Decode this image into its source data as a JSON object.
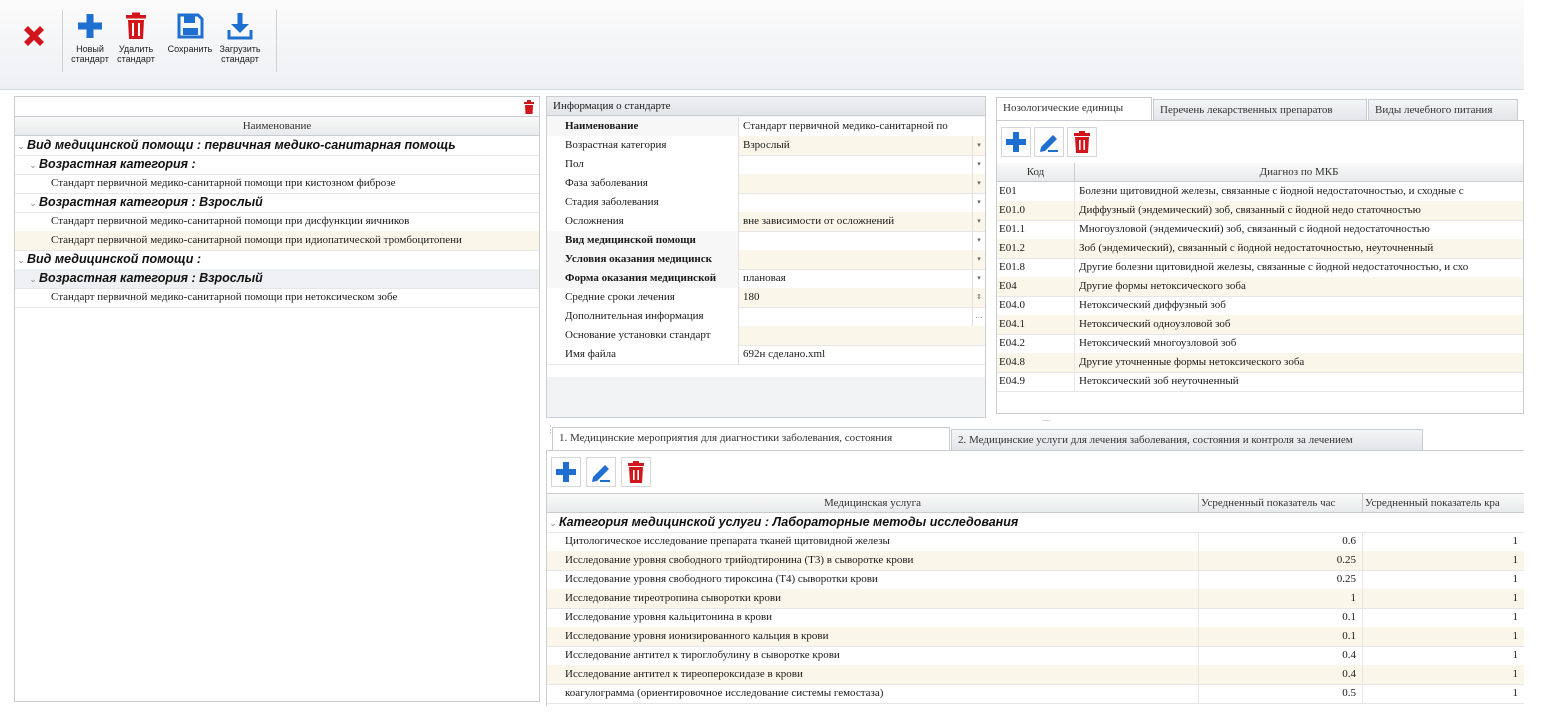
{
  "toolbar": {
    "close_label": "",
    "new_label": "Новый\nстандарт",
    "delete_label": "Удалить\nстандарт",
    "save_label": "Сохранить",
    "load_label": "Загрузить\nстандарт"
  },
  "colors": {
    "accent_blue": "#1f6fd1",
    "danger_red": "#d0151b",
    "row_alt": "#fbf6ea"
  },
  "left_panel": {
    "filter_value": "",
    "column_header": "Наименование",
    "rows": [
      {
        "type": "group",
        "level": 0,
        "text": "Вид медицинской помощи : первичная медико-санитарная помощь"
      },
      {
        "type": "group",
        "level": 1,
        "text": "Возрастная категория :"
      },
      {
        "type": "item",
        "text": "Стандарт первичной медико-санитарной помощи при кистозном фиброзе"
      },
      {
        "type": "group",
        "level": 1,
        "text": "Возрастная категория : Взрослый"
      },
      {
        "type": "item",
        "text": "Стандарт первичной медико-санитарной помощи при дисфункции яичников"
      },
      {
        "type": "item",
        "text": "Стандарт первичной медико-санитарной помощи при идиопатической тромбоцитопени"
      },
      {
        "type": "group",
        "level": 0,
        "text": "Вид медицинской помощи :"
      },
      {
        "type": "group",
        "level": 1,
        "text": "Возрастная категория : Взрослый",
        "selected": true
      },
      {
        "type": "item",
        "text": "Стандарт первичной медико-санитарной помощи при нетоксическом зобе"
      }
    ]
  },
  "info_panel": {
    "title": "Информация о стандарте",
    "fields": [
      {
        "label": "Наименование",
        "value": "Стандарт первичной медико-санитарной по",
        "bold": true,
        "editor": "none"
      },
      {
        "label": "Возрастная категория",
        "value": "Взрослый",
        "editor": "dropdown"
      },
      {
        "label": "Пол",
        "value": "",
        "editor": "dropdown"
      },
      {
        "label": "Фаза заболевания",
        "value": "",
        "editor": "dropdown"
      },
      {
        "label": "Стадия заболевания",
        "value": "",
        "editor": "dropdown"
      },
      {
        "label": "Осложнения",
        "value": "вне зависимости от осложнений",
        "editor": "dropdown"
      },
      {
        "label": "Вид медицинской помощи",
        "value": "",
        "bold": true,
        "editor": "dropdown"
      },
      {
        "label": "Условия оказания медицинск",
        "value": "",
        "bold": true,
        "editor": "dropdown"
      },
      {
        "label": "Форма оказания медицинской",
        "value": "плановая",
        "bold": true,
        "editor": "dropdown"
      },
      {
        "label": "Средние сроки лечения",
        "value": "180",
        "editor": "spin"
      },
      {
        "label": "Дополнительная информация",
        "value": "",
        "editor": "ellipsis"
      },
      {
        "label": "Основание установки стандарт",
        "value": "",
        "editor": "none"
      },
      {
        "label": "Имя файла",
        "value": "692н сделано.xml",
        "editor": "none"
      }
    ]
  },
  "nosology": {
    "tabs": [
      "Нозологические единицы",
      "Перечень лекарственных препаратов",
      "Виды лечебного питания"
    ],
    "columns": [
      "Код",
      "Диагноз по МКБ"
    ],
    "rows": [
      [
        "E01",
        "Болезни щитовидной железы, связанные с йодной недостаточностью, и сходные с"
      ],
      [
        "E01.0",
        "Диффузный (эндемический) зоб, связанный с йодной недо статочностью"
      ],
      [
        "E01.1",
        "Многоузловой (эндемический) зоб, связанный с йодной недостаточностью"
      ],
      [
        "E01.2",
        "Зоб (эндемический), связанный с йодной недостаточностью, неуточненный"
      ],
      [
        "E01.8",
        "Другие болезни щитовидной железы, связанные с йодной недостаточностью, и схо"
      ],
      [
        "E04",
        "Другие формы нетоксического зоба"
      ],
      [
        "E04.0",
        "Нетоксический диффузный зоб"
      ],
      [
        "E04.1",
        "Нетоксический одноузловой зоб"
      ],
      [
        "E04.2",
        "Нетоксический многоузловой зоб"
      ],
      [
        "E04.8",
        "Другие уточненные формы нетоксического зоба"
      ],
      [
        "E04.9",
        "Нетоксический зоб неуточненный"
      ]
    ]
  },
  "services": {
    "tabs": [
      "1. Медицинские мероприятия для диагностики заболевания, состояния",
      "2. Медицинские услуги для лечения заболевания, состояния и контроля за лечением"
    ],
    "columns": [
      "Медицинская услуга",
      "Усредненный показатель час",
      "Усредненный показатель кра"
    ],
    "group": "Категория медицинской услуги : Лабораторные методы исследования",
    "rows": [
      [
        "Цитологическое исследование препарата тканей щитовидной железы",
        "0.6",
        "1"
      ],
      [
        "Исследование уровня свободного трийодтиронина (Т3) в сыворотке крови",
        "0.25",
        "1"
      ],
      [
        "Исследование уровня свободного тироксина (Т4) сыворотки крови",
        "0.25",
        "1"
      ],
      [
        "Исследование тиреотропина сыворотки крови",
        "1",
        "1"
      ],
      [
        "Исследование уровня кальцитонина в крови",
        "0.1",
        "1"
      ],
      [
        "Исследование уровня ионизированного кальция в крови",
        "0.1",
        "1"
      ],
      [
        "Исследование антител к тироглобулину в сыворотке крови",
        "0.4",
        "1"
      ],
      [
        "Исследование антител к тиреопероксидазе в крови",
        "0.4",
        "1"
      ],
      [
        "коагулограмма (ориентировочное исследование системы гемостаза)",
        "0.5",
        "1"
      ]
    ]
  },
  "splitter_label": "...."
}
